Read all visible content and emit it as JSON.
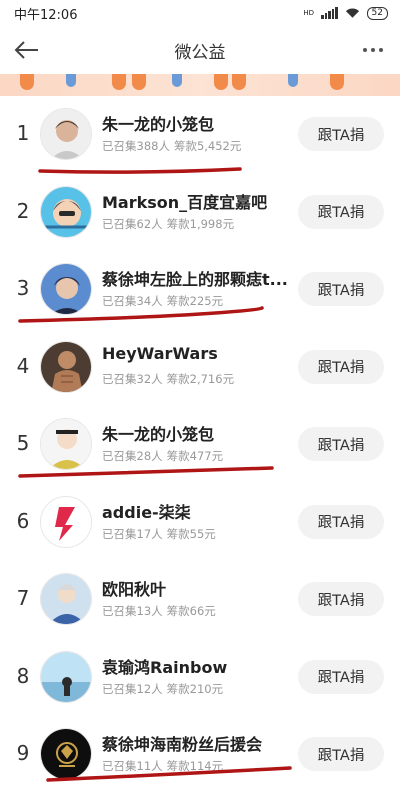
{
  "status_bar": {
    "time": "中午12:06",
    "network": "HD",
    "battery": "52"
  },
  "nav": {
    "title": "微公益"
  },
  "donors": [
    {
      "rank": "1",
      "name": "朱一龙的小笼包",
      "people": "已召集388人",
      "amount": "筹款5,452元",
      "button": "跟TA捐"
    },
    {
      "rank": "2",
      "name": "Markson_百度宜嘉吧",
      "people": "已召集62人",
      "amount": "筹款1,998元",
      "button": "跟TA捐"
    },
    {
      "rank": "3",
      "name": "蔡徐坤左脸上的那颗痣t...",
      "people": "已召集34人",
      "amount": "筹款225元",
      "button": "跟TA捐"
    },
    {
      "rank": "4",
      "name": "HeyWarWars",
      "people": "已召集32人",
      "amount": "筹款2,716元",
      "button": "跟TA捐"
    },
    {
      "rank": "5",
      "name": "朱一龙的小笼包",
      "people": "已召集28人",
      "amount": "筹款477元",
      "button": "跟TA捐"
    },
    {
      "rank": "6",
      "name": "addie-柒柒",
      "people": "已召集17人",
      "amount": "筹款55元",
      "button": "跟TA捐"
    },
    {
      "rank": "7",
      "name": "欧阳秋叶",
      "people": "已召集13人",
      "amount": "筹款66元",
      "button": "跟TA捐"
    },
    {
      "rank": "8",
      "name": "袁瑜鸿Rainbow",
      "people": "已召集12人",
      "amount": "筹款210元",
      "button": "跟TA捐"
    },
    {
      "rank": "9",
      "name": "蔡徐坤海南粉丝后援会",
      "people": "已召集11人",
      "amount": "筹款114元",
      "button": "跟TA捐"
    }
  ],
  "colors": {
    "underline": "#b01515",
    "button_bg": "#f2f2f2",
    "muted_text": "#999999"
  }
}
